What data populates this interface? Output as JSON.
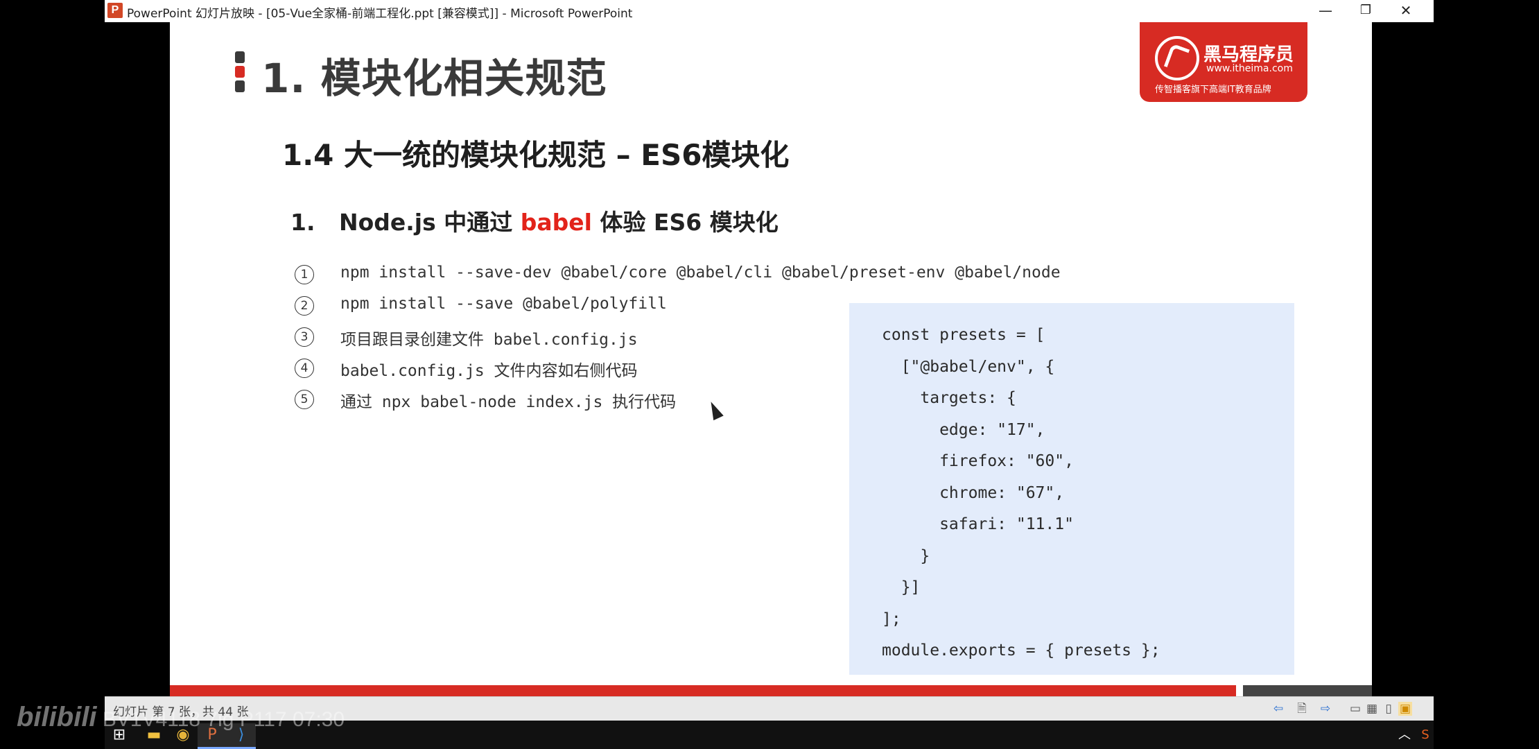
{
  "window": {
    "app_icon_letter": "P",
    "title": "PowerPoint 幻灯片放映 - [05-Vue全家桶-前端工程化.ppt [兼容模式]] - Microsoft PowerPoint",
    "minimize": "—",
    "restore": "❐",
    "close": "✕"
  },
  "slide": {
    "heading": "1. 模块化相关规范",
    "subheading": "1.4 大一统的模块化规范 – ES6模块化",
    "section_prefix": "1.   Node.js 中通过 ",
    "section_accent": "babel",
    "section_suffix": " 体验 ES6 模块化",
    "steps": [
      {
        "num": "1",
        "text": "npm install --save-dev @babel/core @babel/cli @babel/preset-env @babel/node"
      },
      {
        "num": "2",
        "text": "npm install --save @babel/polyfill"
      },
      {
        "num": "3",
        "text": "项目跟目录创建文件 babel.config.js"
      },
      {
        "num": "4",
        "text": "babel.config.js 文件内容如右侧代码"
      },
      {
        "num": "5",
        "text": "通过 npx babel-node index.js 执行代码"
      }
    ],
    "code": "const presets = [\n  [\"@babel/env\", {\n    targets: {\n      edge: \"17\",\n      firefox: \"60\",\n      chrome: \"67\",\n      safari: \"11.1\"\n    }\n  }]\n];\nmodule.exports = { presets };",
    "logo": {
      "name": "黑马程序员",
      "url": "www.itheima.com",
      "tagline": "传智播客旗下高端IT教育品牌"
    },
    "colors": {
      "accent": "#e2231a",
      "code_bg": "#e3ecfb",
      "bullet_red": "#d72b23",
      "bullet_dark": "#3a3a3a"
    }
  },
  "statusbar": {
    "slide_info": "幻灯片 第 7 张，共 44 张"
  },
  "watermark": {
    "brand": "bilibili",
    "text": "BV1V4118 7ig P117 07:30"
  },
  "taskbar": {
    "start_icon": "windows-start-icon",
    "apps": [
      "file-explorer-icon",
      "chrome-icon",
      "powerpoint-icon",
      "vscode-icon"
    ]
  }
}
